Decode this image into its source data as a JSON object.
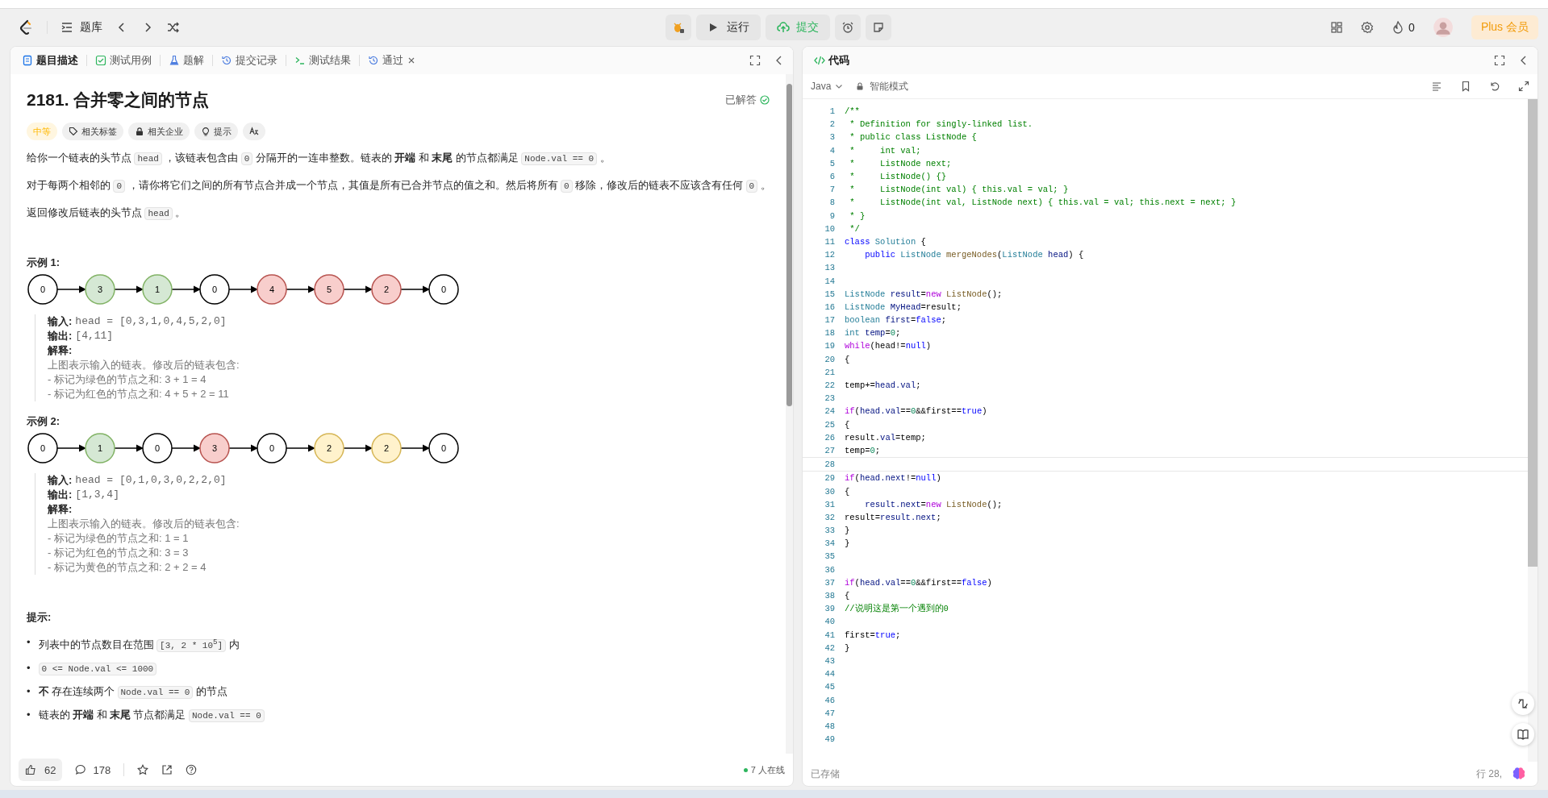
{
  "nav": {
    "library": "题库",
    "run": "运行",
    "submit": "提交",
    "streak": "0",
    "plus": "Plus 会员"
  },
  "left_tabs": [
    {
      "label": "题目描述",
      "selected": true
    },
    {
      "label": "测试用例",
      "selected": false
    },
    {
      "label": "题解",
      "selected": false
    },
    {
      "label": "提交记录",
      "selected": false
    },
    {
      "label": "测试结果",
      "selected": false
    },
    {
      "label": "通过",
      "selected": false,
      "closable": true
    }
  ],
  "problem": {
    "title": "2181. 合并零之间的节点",
    "status": "已解答",
    "difficulty": "中等",
    "tags": [
      {
        "label": "相关标签"
      },
      {
        "label": "相关企业"
      },
      {
        "label": "提示"
      }
    ],
    "paragraphs": [
      [
        {
          "kind": "text",
          "text": "给你一个链表的头节点 "
        },
        {
          "kind": "code",
          "text": "head"
        },
        {
          "kind": "text",
          "text": " ，该链表包含由 "
        },
        {
          "kind": "code",
          "text": "0"
        },
        {
          "kind": "text",
          "text": " 分隔开的一连串整数。链表的 **开端** 和 **末尾** 的节点都满足 "
        },
        {
          "kind": "code",
          "text": "Node.val == 0"
        },
        {
          "kind": "text",
          "text": " 。"
        }
      ],
      [
        {
          "kind": "text",
          "text": "对于每两个相邻的 "
        },
        {
          "kind": "code",
          "text": "0"
        },
        {
          "kind": "text",
          "text": " ，请你将它们之间的所有节点合并成一个节点，其值是所有已合并节点的值之和。然后将所有 "
        },
        {
          "kind": "code",
          "text": "0"
        },
        {
          "kind": "text",
          "text": " 移除，修改后的链表不应该含有任何 "
        },
        {
          "kind": "code",
          "text": "0"
        },
        {
          "kind": "text",
          "text": " 。"
        }
      ],
      [
        {
          "kind": "text",
          "text": " 返回修改后链表的头节点 "
        },
        {
          "kind": "code",
          "text": "head"
        },
        {
          "kind": "text",
          "text": " 。"
        }
      ]
    ],
    "examples": [
      {
        "title": "示例 1:",
        "nodes": [
          {
            "value": "0",
            "color": "#ffffff"
          },
          {
            "value": "3",
            "color": "#d5e8d4"
          },
          {
            "value": "1",
            "color": "#d5e8d4"
          },
          {
            "value": "0",
            "color": "#ffffff"
          },
          {
            "value": "4",
            "color": "#f8cecc"
          },
          {
            "value": "5",
            "color": "#f8cecc"
          },
          {
            "value": "2",
            "color": "#f8cecc"
          },
          {
            "value": "0",
            "color": "#ffffff"
          }
        ],
        "fields": [
          {
            "label": "输入:",
            "value": "head = [0,3,1,0,4,5,2,0]"
          },
          {
            "label": "输出:",
            "value": "[4,11]"
          },
          {
            "label": "解释:"
          }
        ],
        "explanation": [
          "上图表示输入的链表。修改后的链表包含:",
          "- 标记为绿色的节点之和: 3 + 1 = 4",
          "- 标记为红色的节点之和: 4 + 5 + 2 = 11"
        ]
      },
      {
        "title": "示例 2:",
        "nodes": [
          {
            "value": "0",
            "color": "#ffffff"
          },
          {
            "value": "1",
            "color": "#d5e8d4"
          },
          {
            "value": "0",
            "color": "#ffffff"
          },
          {
            "value": "3",
            "color": "#f8cecc"
          },
          {
            "value": "0",
            "color": "#ffffff"
          },
          {
            "value": "2",
            "color": "#fff2cc"
          },
          {
            "value": "2",
            "color": "#fff2cc"
          },
          {
            "value": "0",
            "color": "#ffffff"
          }
        ],
        "fields": [
          {
            "label": "输入:",
            "value": "head = [0,1,0,3,0,2,2,0]"
          },
          {
            "label": "输出:",
            "value": "[1,3,4]"
          },
          {
            "label": "解释:"
          }
        ],
        "explanation": [
          "上图表示输入的链表。修改后的链表包含:",
          "- 标记为绿色的节点之和: 1 = 1",
          "- 标记为红色的节点之和: 3 = 3",
          "- 标记为黄色的节点之和: 2 + 2 = 4"
        ]
      }
    ],
    "hints_title": "提示:",
    "constraints": [
      {
        "bullet": "•",
        "segments": [
          {
            "kind": "text",
            "text": "列表中的节点数目在范围 "
          },
          {
            "kind": "code",
            "text": "[3, 2 * 10$^{5}$]"
          },
          {
            "kind": "text",
            "text": " 内"
          }
        ]
      },
      {
        "bullet": "•",
        "segments": [
          {
            "kind": "code",
            "text": "0 <= Node.val <= 1000"
          }
        ]
      },
      {
        "bullet": "•",
        "segments": [
          {
            "kind": "text",
            "text": "**不** 存在连续两个 "
          },
          {
            "kind": "code",
            "text": "Node.val == 0"
          },
          {
            "kind": "text",
            "text": " 的节点"
          }
        ]
      },
      {
        "bullet": "•",
        "segments": [
          {
            "kind": "text",
            "text": "链表的 **开端** 和 **末尾** 节点都满足 "
          },
          {
            "kind": "code",
            "text": "Node.val == 0"
          }
        ]
      }
    ]
  },
  "left_footer": {
    "likes": "62",
    "comments": "178",
    "online": "7 人在线"
  },
  "editor": {
    "title": "代码",
    "language": "Java",
    "mode": "智能模式",
    "saved": "已存储",
    "position": "行 28,",
    "lines": [
      {
        "n": "1",
        "tokens": [
          {
            "kind": "comment",
            "t": "/**"
          }
        ]
      },
      {
        "n": "2",
        "tokens": [
          {
            "kind": "comment",
            "t": " * Definition for singly-linked list."
          }
        ]
      },
      {
        "n": "3",
        "tokens": [
          {
            "kind": "comment",
            "t": " * public class ListNode {"
          }
        ]
      },
      {
        "n": "4",
        "tokens": [
          {
            "kind": "comment",
            "t": " *     int val;"
          }
        ]
      },
      {
        "n": "5",
        "tokens": [
          {
            "kind": "comment",
            "t": " *     ListNode next;"
          }
        ]
      },
      {
        "n": "6",
        "tokens": [
          {
            "kind": "comment",
            "t": " *     ListNode() {}"
          }
        ]
      },
      {
        "n": "7",
        "tokens": [
          {
            "kind": "comment",
            "t": " *     ListNode(int val) { this.val = val; }"
          }
        ]
      },
      {
        "n": "8",
        "tokens": [
          {
            "kind": "comment",
            "t": " *     ListNode(int val, ListNode next) { this.val = val; this.next = next; }"
          }
        ]
      },
      {
        "n": "9",
        "tokens": [
          {
            "kind": "comment",
            "t": " * }"
          }
        ]
      },
      {
        "n": "10",
        "tokens": [
          {
            "kind": "comment",
            "t": " */"
          }
        ]
      },
      {
        "n": "11",
        "tokens": [
          {
            "kind": "kw",
            "t": "class"
          },
          {
            "kind": "type",
            "t": " Solution"
          },
          {
            "kind": "plain",
            "t": " {"
          }
        ]
      },
      {
        "n": "12",
        "tokens": [
          {
            "kind": "kw",
            "t": "    public"
          },
          {
            "kind": "type",
            "t": " ListNode"
          },
          {
            "kind": "fn",
            "t": " mergeNodes"
          },
          {
            "kind": "plain",
            "t": "("
          },
          {
            "kind": "type",
            "t": "ListNode"
          },
          {
            "kind": "var",
            "t": " head"
          },
          {
            "kind": "plain",
            "t": ") {"
          }
        ]
      },
      {
        "n": "13"
      },
      {
        "n": "14"
      },
      {
        "n": "15",
        "tokens": [
          {
            "kind": "type",
            "t": "ListNode"
          },
          {
            "kind": "var",
            "t": " result"
          },
          {
            "kind": "plain",
            "t": "="
          },
          {
            "kind": "ctl",
            "t": "new"
          },
          {
            "kind": "fn",
            "t": " ListNode"
          },
          {
            "kind": "plain",
            "t": "();"
          }
        ]
      },
      {
        "n": "16",
        "tokens": [
          {
            "kind": "type",
            "t": "ListNode"
          },
          {
            "kind": "var",
            "t": " MyHead"
          },
          {
            "kind": "plain",
            "t": "=result;"
          }
        ]
      },
      {
        "n": "17",
        "tokens": [
          {
            "kind": "type",
            "t": "boolean"
          },
          {
            "kind": "var",
            "t": " first"
          },
          {
            "kind": "plain",
            "t": "="
          },
          {
            "kind": "kw",
            "t": "false"
          },
          {
            "kind": "plain",
            "t": ";"
          }
        ]
      },
      {
        "n": "18",
        "tokens": [
          {
            "kind": "type",
            "t": "int"
          },
          {
            "kind": "var",
            "t": " temp"
          },
          {
            "kind": "plain",
            "t": "="
          },
          {
            "kind": "num",
            "t": "0"
          },
          {
            "kind": "plain",
            "t": ";"
          }
        ]
      },
      {
        "n": "19",
        "tokens": [
          {
            "kind": "ctl",
            "t": "while"
          },
          {
            "kind": "plain",
            "t": "(head!="
          },
          {
            "kind": "kw",
            "t": "null"
          },
          {
            "kind": "plain",
            "t": ")"
          }
        ]
      },
      {
        "n": "20",
        "tokens": [
          {
            "kind": "plain",
            "t": "{"
          }
        ]
      },
      {
        "n": "21"
      },
      {
        "n": "22",
        "tokens": [
          {
            "kind": "plain",
            "t": "temp+="
          },
          {
            "kind": "var",
            "t": "head.val"
          },
          {
            "kind": "plain",
            "t": ";"
          }
        ]
      },
      {
        "n": "23"
      },
      {
        "n": "24",
        "tokens": [
          {
            "kind": "ctl",
            "t": "if"
          },
          {
            "kind": "plain",
            "t": "("
          },
          {
            "kind": "var",
            "t": "head.val"
          },
          {
            "kind": "plain",
            "t": "=="
          },
          {
            "kind": "num",
            "t": "0"
          },
          {
            "kind": "plain",
            "t": "&&first=="
          },
          {
            "kind": "kw",
            "t": "true"
          },
          {
            "kind": "plain",
            "t": ")"
          }
        ]
      },
      {
        "n": "25",
        "tokens": [
          {
            "kind": "plain",
            "t": "{"
          }
        ]
      },
      {
        "n": "26",
        "tokens": [
          {
            "kind": "plain",
            "t": "result."
          },
          {
            "kind": "var",
            "t": "val"
          },
          {
            "kind": "plain",
            "t": "=temp;"
          }
        ]
      },
      {
        "n": "27",
        "tokens": [
          {
            "kind": "plain",
            "t": "temp="
          },
          {
            "kind": "num",
            "t": "0"
          },
          {
            "kind": "plain",
            "t": ";"
          }
        ]
      },
      {
        "n": "28",
        "current": true
      },
      {
        "n": "29",
        "tokens": [
          {
            "kind": "ctl",
            "t": "if"
          },
          {
            "kind": "plain",
            "t": "("
          },
          {
            "kind": "var",
            "t": "head.next"
          },
          {
            "kind": "plain",
            "t": "!="
          },
          {
            "kind": "kw",
            "t": "null"
          },
          {
            "kind": "plain",
            "t": ")"
          }
        ]
      },
      {
        "n": "30",
        "tokens": [
          {
            "kind": "plain",
            "t": "{"
          }
        ]
      },
      {
        "n": "31",
        "tokens": [
          {
            "kind": "var",
            "t": "    result.next"
          },
          {
            "kind": "plain",
            "t": "="
          },
          {
            "kind": "ctl",
            "t": "new"
          },
          {
            "kind": "fn",
            "t": " ListNode"
          },
          {
            "kind": "plain",
            "t": "();"
          }
        ]
      },
      {
        "n": "32",
        "tokens": [
          {
            "kind": "plain",
            "t": "result="
          },
          {
            "kind": "var",
            "t": "result.next"
          },
          {
            "kind": "plain",
            "t": ";"
          }
        ]
      },
      {
        "n": "33",
        "tokens": [
          {
            "kind": "plain",
            "t": "}"
          }
        ]
      },
      {
        "n": "34",
        "tokens": [
          {
            "kind": "plain",
            "t": "}"
          }
        ]
      },
      {
        "n": "35"
      },
      {
        "n": "36"
      },
      {
        "n": "37",
        "tokens": [
          {
            "kind": "ctl",
            "t": "if"
          },
          {
            "kind": "plain",
            "t": "("
          },
          {
            "kind": "var",
            "t": "head.val"
          },
          {
            "kind": "plain",
            "t": "=="
          },
          {
            "kind": "num",
            "t": "0"
          },
          {
            "kind": "plain",
            "t": "&&first=="
          },
          {
            "kind": "kw",
            "t": "false"
          },
          {
            "kind": "plain",
            "t": ")"
          }
        ]
      },
      {
        "n": "38",
        "tokens": [
          {
            "kind": "plain",
            "t": "{"
          }
        ]
      },
      {
        "n": "39",
        "tokens": [
          {
            "kind": "comment",
            "t": "//说明这是第一个遇到的0"
          }
        ]
      },
      {
        "n": "40"
      },
      {
        "n": "41",
        "tokens": [
          {
            "kind": "plain",
            "t": "first="
          },
          {
            "kind": "kw",
            "t": "true"
          },
          {
            "kind": "plain",
            "t": ";"
          }
        ]
      },
      {
        "n": "42",
        "tokens": [
          {
            "kind": "plain",
            "t": "}"
          }
        ]
      },
      {
        "n": "43"
      },
      {
        "n": "44"
      },
      {
        "n": "45"
      },
      {
        "n": "46"
      },
      {
        "n": "47"
      },
      {
        "n": "48"
      },
      {
        "n": "49"
      }
    ]
  }
}
